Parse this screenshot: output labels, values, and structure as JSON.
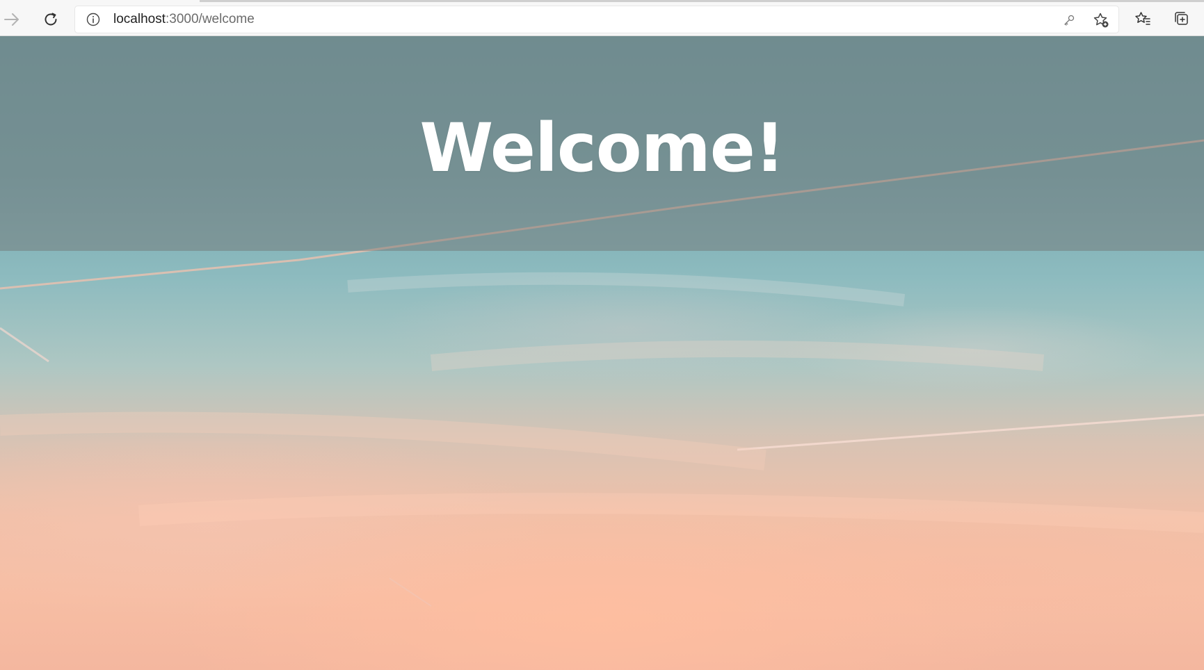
{
  "browser": {
    "url_host": "localhost",
    "url_rest": ":3000/welcome",
    "icons": {
      "forward": "forward-arrow-icon",
      "refresh": "refresh-icon",
      "info": "info-icon",
      "key": "key-icon",
      "add_favorite": "star-add-icon",
      "favorites": "favorites-icon",
      "collections": "collections-icon"
    }
  },
  "page": {
    "hero_title": "Welcome!"
  },
  "colors": {
    "hero_overlay": "#707070",
    "title_text": "#ffffff",
    "sky_top": "#6fa2a8",
    "sky_bottom": "#f4b79f"
  }
}
